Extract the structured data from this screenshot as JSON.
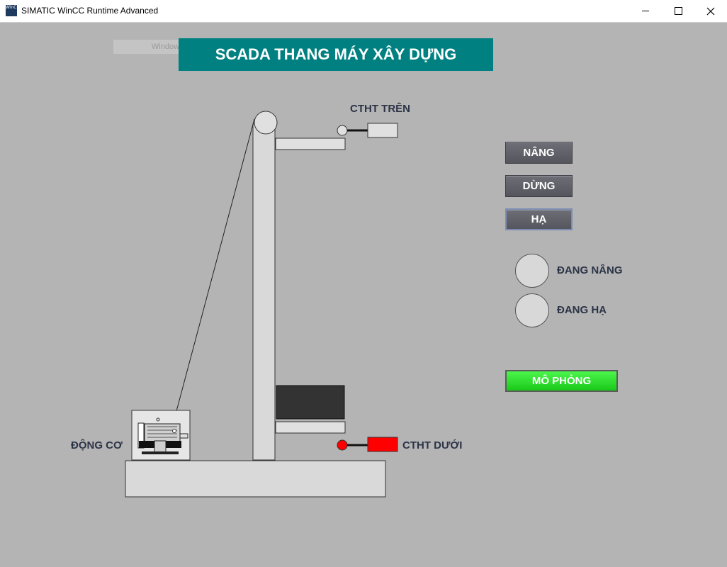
{
  "window": {
    "title": "SIMATIC WinCC Runtime Advanced",
    "icon_text": "WinCC"
  },
  "watermark": "Window Snip",
  "header": {
    "title": "SCADA THANG MÁY XÂY DỰNG"
  },
  "sensors": {
    "top_label": "CTHT TRÊN",
    "bottom_label": "CTHT DƯỚI",
    "top_active": false,
    "bottom_active": true,
    "active_color": "#ff0000",
    "inactive_color": "#e0e0e0"
  },
  "motor": {
    "label": "ĐỘNG CƠ"
  },
  "controls": {
    "up": "NÂNG",
    "stop": "DỪNG",
    "down": "HẠ",
    "simulate": "MÔ PHỎNG"
  },
  "indicators": {
    "raising": "ĐANG NÂNG",
    "lowering": "ĐANG HẠ"
  },
  "colors": {
    "header_bg": "#008080",
    "background": "#b4b4b4",
    "simulate_button": "#2ee02e",
    "cabin": "#333333"
  }
}
